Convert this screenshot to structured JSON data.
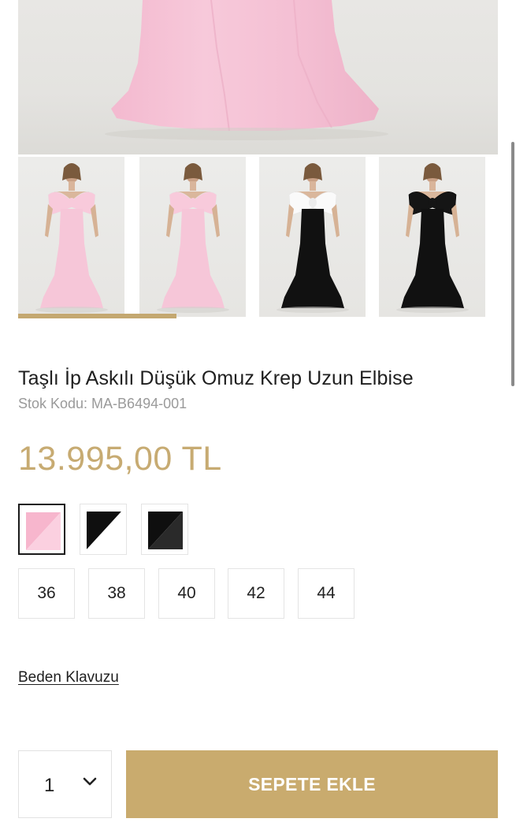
{
  "product": {
    "title": "Taşlı İp Askılı Düşük Omuz Krep Uzun Elbise",
    "sku": "Stok Kodu: MA-B6494-001",
    "price": "13.995,00 TL"
  },
  "gallery": {
    "thumbnails": [
      {
        "variant": "pink",
        "dress_color": "#f6c6d8",
        "bow_color": "#f8cadb"
      },
      {
        "variant": "pink",
        "dress_color": "#f6c6d8",
        "bow_color": "#f8cadb"
      },
      {
        "variant": "black-white",
        "dress_color": "#111111",
        "bow_color": "#fafafa"
      },
      {
        "variant": "black",
        "dress_color": "#111111",
        "bow_color": "#151515"
      }
    ],
    "progress_fraction": 0.33
  },
  "colors": [
    {
      "name": "pink",
      "primary": "#f8bcd2",
      "secondary": "#fbd3e2",
      "selected": true
    },
    {
      "name": "black-white",
      "primary": "#0f0f0f",
      "secondary": "#ffffff",
      "selected": false
    },
    {
      "name": "black",
      "primary": "#0f0f0f",
      "secondary": "#2a2a2a",
      "selected": false
    }
  ],
  "sizes": [
    "36",
    "38",
    "40",
    "42",
    "44"
  ],
  "size_guide_label": "Beden Klavuzu",
  "quantity": {
    "value": "1",
    "icon": "chevron-down-icon"
  },
  "add_to_cart_label": "SEPETE EKLE",
  "theme": {
    "accent": "#c9ab6e",
    "price": "#c7ab72"
  }
}
